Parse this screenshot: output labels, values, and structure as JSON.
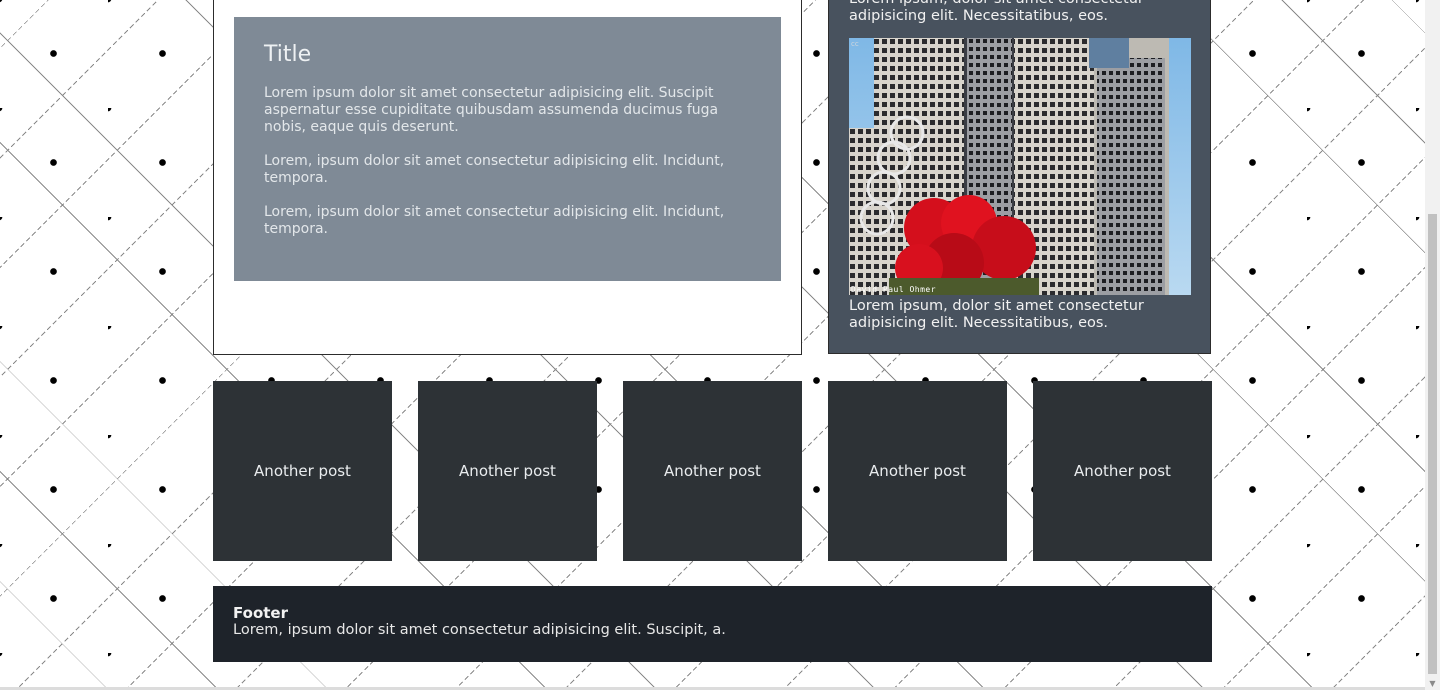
{
  "main": {
    "panel_title": "Title",
    "paragraphs": [
      "Lorem ipsum dolor sit amet consectetur adipisicing elit. Suscipit aspernatur esse cupiditate quibusdam assumenda ducimus fuga nobis, eaque quis deserunt.",
      "Lorem, ipsum dolor sit amet consectetur adipisicing elit. Incidunt, tempora.",
      "Lorem, ipsum dolor sit amet consectetur adipisicing elit. Incidunt, tempora."
    ]
  },
  "sidebar": {
    "top_text": "Lorem ipsum, dolor sit amet consectetur adipisicing elit. Necessitatibus, eos.",
    "photo_credit": "David Paul Ohmer",
    "photo_badge": "cc",
    "bottom_text": "Lorem ipsum, dolor sit amet consectetur adipisicing elit. Necessitatibus, eos."
  },
  "posts": [
    {
      "label": "Another post"
    },
    {
      "label": "Another post"
    },
    {
      "label": "Another post"
    },
    {
      "label": "Another post"
    },
    {
      "label": "Another post"
    }
  ],
  "footer": {
    "title": "Footer",
    "text": "Lorem, ipsum dolor sit amet consectetur adipisicing elit. Suscipit, a."
  },
  "colors": {
    "panel": "#7f8a96",
    "sidebar": "#48525e",
    "post": "#2d3236",
    "footer": "#1e232a"
  }
}
